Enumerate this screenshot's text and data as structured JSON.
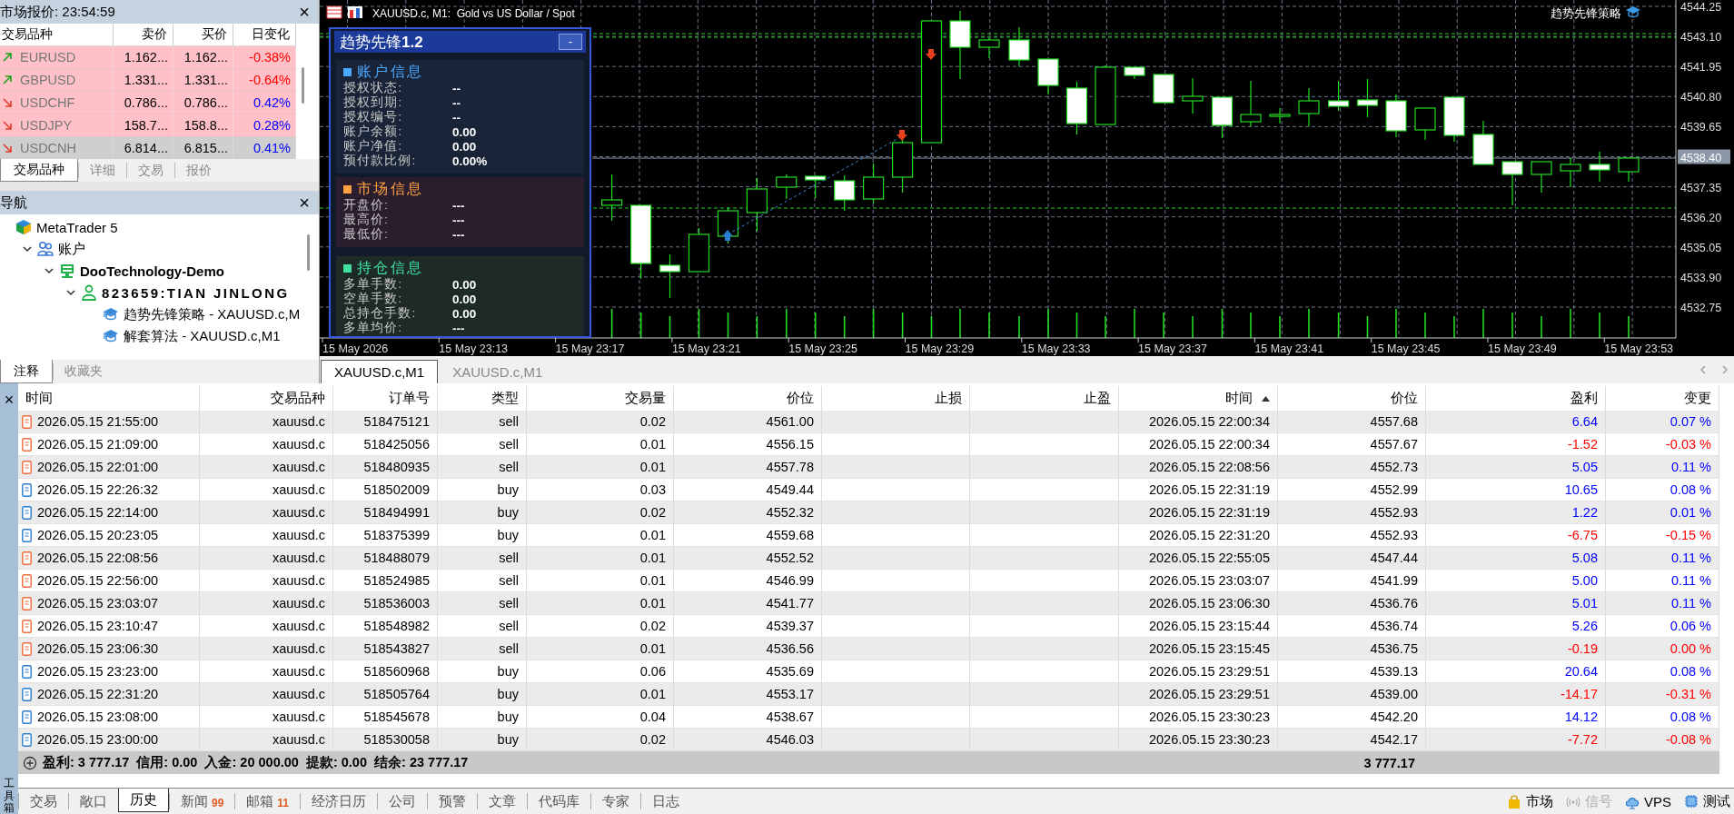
{
  "market_watch": {
    "title": "市场报价: 23:54:59",
    "close": "×",
    "columns": [
      "交易品种",
      "卖价",
      "买价",
      "日变化"
    ],
    "rows": [
      {
        "symbol": "EURUSD",
        "bid": "1.162...",
        "ask": "1.162...",
        "change": "-0.38%",
        "rising": true,
        "falling": true,
        "selected": false
      },
      {
        "symbol": "GBPUSD",
        "bid": "1.331...",
        "ask": "1.331...",
        "change": "-0.64%",
        "rising": true,
        "falling": true,
        "selected": false
      },
      {
        "symbol": "USDCHF",
        "bid": "0.786...",
        "ask": "0.786...",
        "change": "0.42%",
        "rising": false,
        "falling": false,
        "selected": false
      },
      {
        "symbol": "USDJPY",
        "bid": "158.7...",
        "ask": "158.8...",
        "change": "0.28%",
        "rising": false,
        "falling": false,
        "selected": false
      },
      {
        "symbol": "USDCNH",
        "bid": "6.814...",
        "ask": "6.815...",
        "change": "0.41%",
        "rising": false,
        "falling": false,
        "selected": true
      }
    ],
    "tabs": [
      {
        "label": "交易品种",
        "selected": true
      },
      {
        "label": "详细",
        "selected": false
      },
      {
        "label": "交易",
        "selected": false
      },
      {
        "label": "报价",
        "selected": false
      }
    ]
  },
  "navigator": {
    "title": "导航",
    "close": "×",
    "tree": [
      {
        "label": "MetaTrader 5",
        "kind": "root",
        "children": [
          {
            "label": "账户",
            "kind": "accounts",
            "expanded": true,
            "children": [
              {
                "label": "DooTechnology-Demo",
                "kind": "server",
                "expanded": true,
                "children": [
                  {
                    "label": "823659:TIAN JINLONG",
                    "kind": "account",
                    "expanded": true,
                    "children": [
                      {
                        "label": "趋势先锋策略 - XAUUSD.c,M",
                        "kind": "expert"
                      },
                      {
                        "label": "解套算法 - XAUUSD.c,M1",
                        "kind": "expert"
                      }
                    ]
                  }
                ]
              }
            ]
          }
        ]
      }
    ],
    "tabs": [
      {
        "label": "注释",
        "selected": true
      },
      {
        "label": "收藏夹",
        "selected": false
      }
    ]
  },
  "chart": {
    "title": "XAUUSD.c, M1:  Gold vs US Dollar / Spot",
    "ea_label": "趋势先锋策略",
    "price_axis": [
      {
        "label": "4544.25",
        "current": false
      },
      {
        "label": "4543.10",
        "current": false
      },
      {
        "label": "4541.95",
        "current": false
      },
      {
        "label": "4540.80",
        "current": false
      },
      {
        "label": "4539.65",
        "current": false
      },
      {
        "label": "4538.40",
        "current": true
      },
      {
        "label": "4537.35",
        "current": false
      },
      {
        "label": "4536.20",
        "current": false
      },
      {
        "label": "4535.05",
        "current": false
      },
      {
        "label": "4533.90",
        "current": false
      },
      {
        "label": "4532.75",
        "current": false
      }
    ],
    "time_axis": [
      "15 May 2026",
      "15 May 23:13",
      "15 May 23:17",
      "15 May 23:21",
      "15 May 23:25",
      "15 May 23:29",
      "15 May 23:33",
      "15 May 23:37",
      "15 May 23:41",
      "15 May 23:45",
      "15 May 23:49",
      "15 May 23:53"
    ],
    "tabs": [
      {
        "label": "XAUUSD.c,M1",
        "selected": true
      },
      {
        "label": "XAUUSD.c,M1",
        "selected": false
      }
    ]
  },
  "ea_panel": {
    "title": "趋势先锋**1.2**",
    "minimize": "-",
    "sections": [
      {
        "heading": "账户信息",
        "color": "#4aa8ff",
        "rows": [
          {
            "label": "授权状态:",
            "value": "--"
          },
          {
            "label": "授权到期:",
            "value": "--"
          },
          {
            "label": "授权编号:",
            "value": "--"
          },
          {
            "label": "账户余额:",
            "value": "0.00"
          },
          {
            "label": "账户净值:",
            "value": "0.00"
          },
          {
            "label": "预付款比例:",
            "value": "0.00%"
          }
        ]
      },
      {
        "heading": "市场信息",
        "color": "#ffa040",
        "rows": [
          {
            "label": "开盘价:",
            "value": "---"
          },
          {
            "label": "最高价:",
            "value": "---"
          },
          {
            "label": "最低价:",
            "value": "---"
          }
        ]
      },
      {
        "heading": "持仓信息",
        "color": "#40e0a0",
        "rows": [
          {
            "label": "多单手数:",
            "value": "0.00"
          },
          {
            "label": "空单手数:",
            "value": "0.00"
          },
          {
            "label": "总持仓手数:",
            "value": "0.00"
          },
          {
            "label": "多单均价:",
            "value": "---"
          }
        ]
      }
    ]
  },
  "toolbox": {
    "label": "工具箱",
    "close": "×",
    "columns": [
      {
        "label": "时间",
        "sorted": false
      },
      {
        "label": "交易品种",
        "sorted": false
      },
      {
        "label": "订单号",
        "sorted": false
      },
      {
        "label": "类型",
        "sorted": false
      },
      {
        "label": "交易量",
        "sorted": false
      },
      {
        "label": "价位",
        "sorted": false
      },
      {
        "label": "止损",
        "sorted": false
      },
      {
        "label": "止盈",
        "sorted": false
      },
      {
        "label": "时间",
        "sorted": true
      },
      {
        "label": "价位",
        "sorted": false
      },
      {
        "label": "盈利",
        "sorted": false
      },
      {
        "label": "变更",
        "sorted": false
      }
    ],
    "rows": [
      {
        "kind": "sell",
        "loss": false,
        "cells": [
          "2026.05.15 21:55:00",
          "xauusd.c",
          "518475121",
          "sell",
          "0.02",
          "4561.00",
          "",
          "",
          "2026.05.15 22:00:34",
          "4557.68",
          "6.64",
          "0.07 %"
        ]
      },
      {
        "kind": "sell",
        "loss": true,
        "cells": [
          "2026.05.15 21:09:00",
          "xauusd.c",
          "518425056",
          "sell",
          "0.01",
          "4556.15",
          "",
          "",
          "2026.05.15 22:00:34",
          "4557.67",
          "-1.52",
          "-0.03 %"
        ]
      },
      {
        "kind": "sell",
        "loss": false,
        "cells": [
          "2026.05.15 22:01:00",
          "xauusd.c",
          "518480935",
          "sell",
          "0.01",
          "4557.78",
          "",
          "",
          "2026.05.15 22:08:56",
          "4552.73",
          "5.05",
          "0.11 %"
        ]
      },
      {
        "kind": "buy",
        "loss": false,
        "cells": [
          "2026.05.15 22:26:32",
          "xauusd.c",
          "518502009",
          "buy",
          "0.03",
          "4549.44",
          "",
          "",
          "2026.05.15 22:31:19",
          "4552.99",
          "10.65",
          "0.08 %"
        ]
      },
      {
        "kind": "buy",
        "loss": false,
        "cells": [
          "2026.05.15 22:14:00",
          "xauusd.c",
          "518494991",
          "buy",
          "0.02",
          "4552.32",
          "",
          "",
          "2026.05.15 22:31:19",
          "4552.93",
          "1.22",
          "0.01 %"
        ]
      },
      {
        "kind": "buy",
        "loss": true,
        "cells": [
          "2026.05.15 20:23:05",
          "xauusd.c",
          "518375399",
          "buy",
          "0.01",
          "4559.68",
          "",
          "",
          "2026.05.15 22:31:20",
          "4552.93",
          "-6.75",
          "-0.15 %"
        ]
      },
      {
        "kind": "sell",
        "loss": false,
        "cells": [
          "2026.05.15 22:08:56",
          "xauusd.c",
          "518488079",
          "sell",
          "0.01",
          "4552.52",
          "",
          "",
          "2026.05.15 22:55:05",
          "4547.44",
          "5.08",
          "0.11 %"
        ]
      },
      {
        "kind": "sell",
        "loss": false,
        "cells": [
          "2026.05.15 22:56:00",
          "xauusd.c",
          "518524985",
          "sell",
          "0.01",
          "4546.99",
          "",
          "",
          "2026.05.15 23:03:07",
          "4541.99",
          "5.00",
          "0.11 %"
        ]
      },
      {
        "kind": "sell",
        "loss": false,
        "cells": [
          "2026.05.15 23:03:07",
          "xauusd.c",
          "518536003",
          "sell",
          "0.01",
          "4541.77",
          "",
          "",
          "2026.05.15 23:06:30",
          "4536.76",
          "5.01",
          "0.11 %"
        ]
      },
      {
        "kind": "sell",
        "loss": false,
        "cells": [
          "2026.05.15 23:10:47",
          "xauusd.c",
          "518548982",
          "sell",
          "0.02",
          "4539.37",
          "",
          "",
          "2026.05.15 23:15:44",
          "4536.74",
          "5.26",
          "0.06 %"
        ]
      },
      {
        "kind": "sell",
        "loss": true,
        "cells": [
          "2026.05.15 23:06:30",
          "xauusd.c",
          "518543827",
          "sell",
          "0.01",
          "4536.56",
          "",
          "",
          "2026.05.15 23:15:45",
          "4536.75",
          "-0.19",
          "0.00 %"
        ]
      },
      {
        "kind": "buy",
        "loss": false,
        "cells": [
          "2026.05.15 23:23:00",
          "xauusd.c",
          "518560968",
          "buy",
          "0.06",
          "4535.69",
          "",
          "",
          "2026.05.15 23:29:51",
          "4539.13",
          "20.64",
          "0.08 %"
        ]
      },
      {
        "kind": "buy",
        "loss": true,
        "cells": [
          "2026.05.15 22:31:20",
          "xauusd.c",
          "518505764",
          "buy",
          "0.01",
          "4553.17",
          "",
          "",
          "2026.05.15 23:29:51",
          "4539.00",
          "-14.17",
          "-0.31 %"
        ]
      },
      {
        "kind": "buy",
        "loss": false,
        "cells": [
          "2026.05.15 23:08:00",
          "xauusd.c",
          "518545678",
          "buy",
          "0.04",
          "4538.67",
          "",
          "",
          "2026.05.15 23:30:23",
          "4542.20",
          "14.12",
          "0.08 %"
        ]
      },
      {
        "kind": "buy",
        "loss": true,
        "cells": [
          "2026.05.15 23:00:00",
          "xauusd.c",
          "518530058",
          "buy",
          "0.02",
          "4546.03",
          "",
          "",
          "2026.05.15 23:30:23",
          "4542.17",
          "-7.72",
          "-0.08 %"
        ]
      }
    ],
    "summary": {
      "text": "盈利: 3 777.17  信用: 0.00  入金: 20 000.00  提款: 0.00  结余: 23 777.17",
      "total": "3 777.17"
    },
    "tabs": [
      {
        "label": "交易",
        "selected": false
      },
      {
        "label": "敞口",
        "selected": false
      },
      {
        "label": "历史",
        "selected": true
      },
      {
        "label": "新闻",
        "count": "99",
        "selected": false
      },
      {
        "label": "邮箱",
        "count": "11",
        "selected": false
      },
      {
        "label": "经济日历",
        "selected": false
      },
      {
        "label": "公司",
        "selected": false
      },
      {
        "label": "预警",
        "selected": false
      },
      {
        "label": "文章",
        "selected": false
      },
      {
        "label": "代码库",
        "selected": false
      },
      {
        "label": "专家",
        "selected": false
      },
      {
        "label": "日志",
        "selected": false
      }
    ],
    "status": [
      {
        "label": "市场",
        "kind": "market",
        "disabled": false
      },
      {
        "label": "信号",
        "kind": "signals",
        "disabled": true
      },
      {
        "label": "VPS",
        "kind": "vps",
        "disabled": false
      },
      {
        "label": "测试",
        "kind": "tester",
        "disabled": false
      }
    ]
  }
}
